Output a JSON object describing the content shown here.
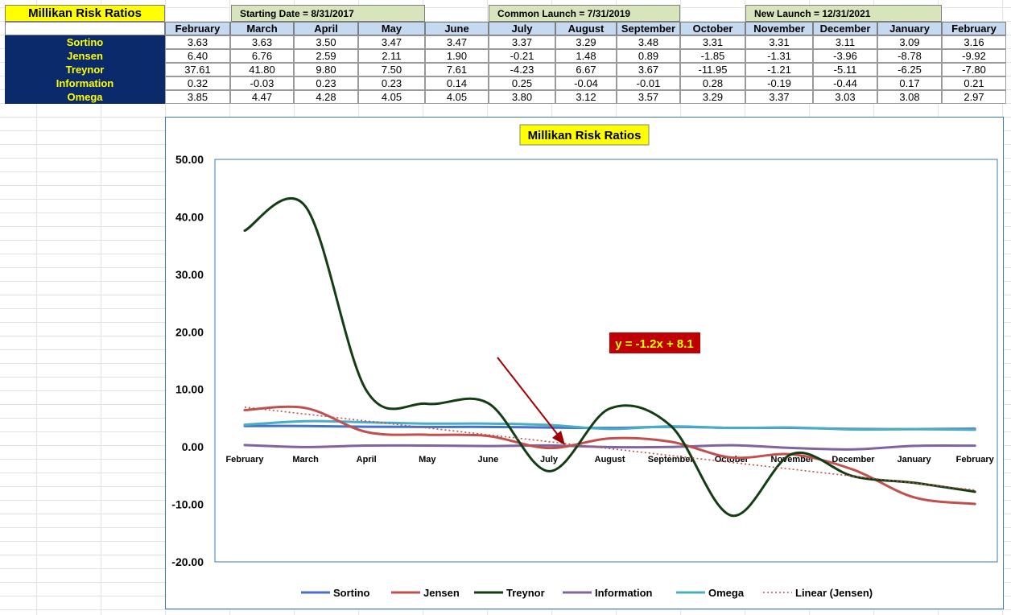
{
  "sheet": {
    "title": "Millikan Risk Ratios",
    "banners": [
      "Starting Date = 8/31/2017",
      "Common Launch = 7/31/2019",
      "New Launch = 12/31/2021"
    ],
    "months": [
      "February",
      "March",
      "April",
      "May",
      "June",
      "July",
      "August",
      "September",
      "October",
      "November",
      "December",
      "January",
      "February"
    ],
    "rows": [
      {
        "label": "Sortino",
        "values": [
          "3.63",
          "3.63",
          "3.50",
          "3.47",
          "3.47",
          "3.37",
          "3.29",
          "3.48",
          "3.31",
          "3.31",
          "3.11",
          "3.09",
          "3.16"
        ]
      },
      {
        "label": "Jensen",
        "values": [
          "6.40",
          "6.76",
          "2.59",
          "2.11",
          "1.90",
          "-0.21",
          "1.48",
          "0.89",
          "-1.85",
          "-1.31",
          "-3.96",
          "-8.78",
          "-9.92"
        ]
      },
      {
        "label": "Treynor",
        "values": [
          "37.61",
          "41.80",
          "9.80",
          "7.50",
          "7.61",
          "-4.23",
          "6.67",
          "3.67",
          "-11.95",
          "-1.21",
          "-5.11",
          "-6.25",
          "-7.80"
        ]
      },
      {
        "label": "Information",
        "values": [
          "0.32",
          "-0.03",
          "0.23",
          "0.23",
          "0.14",
          "0.25",
          "-0.04",
          "-0.01",
          "0.28",
          "-0.19",
          "-0.44",
          "0.17",
          "0.21"
        ]
      },
      {
        "label": "Omega",
        "values": [
          "3.85",
          "4.47",
          "4.28",
          "4.05",
          "4.05",
          "3.80",
          "3.12",
          "3.57",
          "3.29",
          "3.37",
          "3.03",
          "3.08",
          "2.97"
        ]
      }
    ]
  },
  "chart_data": {
    "type": "line",
    "title": "Millikan Risk Ratios",
    "categories": [
      "February",
      "March",
      "April",
      "May",
      "June",
      "July",
      "August",
      "September",
      "October",
      "November",
      "December",
      "January",
      "February"
    ],
    "series": [
      {
        "name": "Sortino",
        "color": "#4472c4",
        "values": [
          3.63,
          3.63,
          3.5,
          3.47,
          3.47,
          3.37,
          3.29,
          3.48,
          3.31,
          3.31,
          3.11,
          3.09,
          3.16
        ]
      },
      {
        "name": "Jensen",
        "color": "#c0504d",
        "values": [
          6.4,
          6.76,
          2.59,
          2.11,
          1.9,
          -0.21,
          1.48,
          0.89,
          -1.85,
          -1.31,
          -3.96,
          -8.78,
          -9.92
        ]
      },
      {
        "name": "Treynor",
        "color": "#133d13",
        "values": [
          37.61,
          41.8,
          9.8,
          7.5,
          7.61,
          -4.23,
          6.67,
          3.67,
          -11.95,
          -1.21,
          -5.11,
          -6.25,
          -7.8
        ]
      },
      {
        "name": "Information",
        "color": "#8064a2",
        "values": [
          0.32,
          -0.03,
          0.23,
          0.23,
          0.14,
          0.25,
          -0.04,
          -0.01,
          0.28,
          -0.19,
          -0.44,
          0.17,
          0.21
        ]
      },
      {
        "name": "Omega",
        "color": "#4bacc6",
        "values": [
          3.85,
          4.47,
          4.28,
          4.05,
          4.05,
          3.8,
          3.12,
          3.57,
          3.29,
          3.37,
          3.03,
          3.08,
          2.97
        ]
      }
    ],
    "trendline": {
      "name": "Linear (Jensen)",
      "color": "#c0504d",
      "slope": -1.2,
      "intercept": 8.1,
      "label": "y = -1.2x + 8.1"
    },
    "ylim": [
      -20,
      50
    ],
    "yticks": [
      "50.00",
      "40.00",
      "30.00",
      "20.00",
      "10.00",
      "0.00",
      "-10.00",
      "-20.00"
    ],
    "ytick_values": [
      50,
      40,
      30,
      20,
      10,
      0,
      -10,
      -20
    ],
    "legend": "bottom",
    "grid": false
  }
}
